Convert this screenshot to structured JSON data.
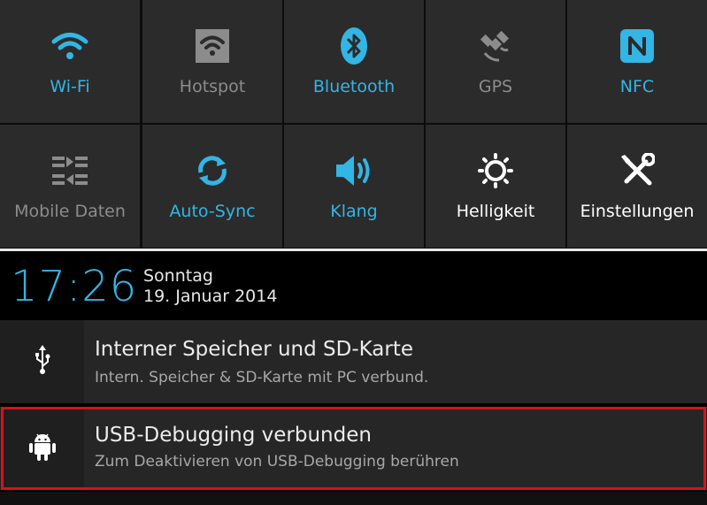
{
  "quick_settings": {
    "row1": [
      {
        "label": "Wi-Fi",
        "icon": "wifi-icon",
        "state": "on"
      },
      {
        "label": "Hotspot",
        "icon": "hotspot-icon",
        "state": "off"
      },
      {
        "label": "Bluetooth",
        "icon": "bluetooth-icon",
        "state": "on"
      },
      {
        "label": "GPS",
        "icon": "gps-icon",
        "state": "off"
      },
      {
        "label": "NFC",
        "icon": "nfc-icon",
        "state": "on"
      }
    ],
    "row2": [
      {
        "label": "Mobile Daten",
        "icon": "mobile-data-icon",
        "state": "off"
      },
      {
        "label": "Auto-Sync",
        "icon": "sync-icon",
        "state": "on"
      },
      {
        "label": "Klang",
        "icon": "volume-icon",
        "state": "on"
      },
      {
        "label": "Helligkeit",
        "icon": "brightness-icon",
        "state": "neutral"
      },
      {
        "label": "Einstellungen",
        "icon": "settings-tools-icon",
        "state": "neutral"
      }
    ]
  },
  "status": {
    "time": "17:26",
    "weekday": "Sonntag",
    "date": "19. Januar 2014"
  },
  "notifications": [
    {
      "icon": "usb-icon",
      "title": "Interner Speicher und SD-Karte",
      "text": "Intern. Speicher & SD-Karte mit PC verbund."
    },
    {
      "icon": "android-icon",
      "title": "USB-Debugging verbunden",
      "text": "Zum Deaktivieren von USB-Debugging berühren",
      "highlighted": true
    }
  ],
  "colors": {
    "accent": "#33b5e5",
    "highlight_border": "#d6121b"
  }
}
